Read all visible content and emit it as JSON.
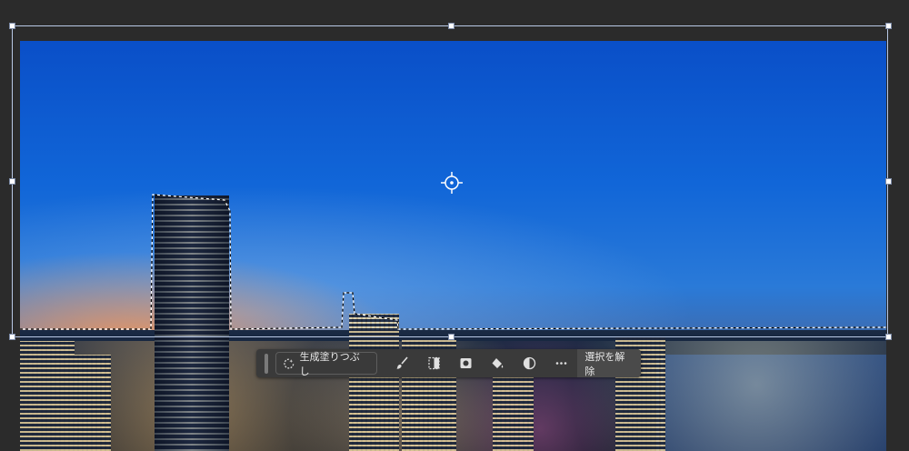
{
  "toolbar": {
    "generative_fill_label": "生成塗りつぶし",
    "deselect_label": "選択を解除",
    "tools": [
      {
        "name": "brush-icon"
      },
      {
        "name": "select-subject-icon"
      },
      {
        "name": "mask-icon"
      },
      {
        "name": "fill-bucket-icon"
      },
      {
        "name": "adjustment-icon"
      },
      {
        "name": "more-icon"
      }
    ]
  },
  "colors": {
    "canvas_bg": "#2b2b2b",
    "toolbar_bg": "#3a3a3a",
    "sky_top": "#0a4fc8",
    "selection": "#ffffff"
  }
}
